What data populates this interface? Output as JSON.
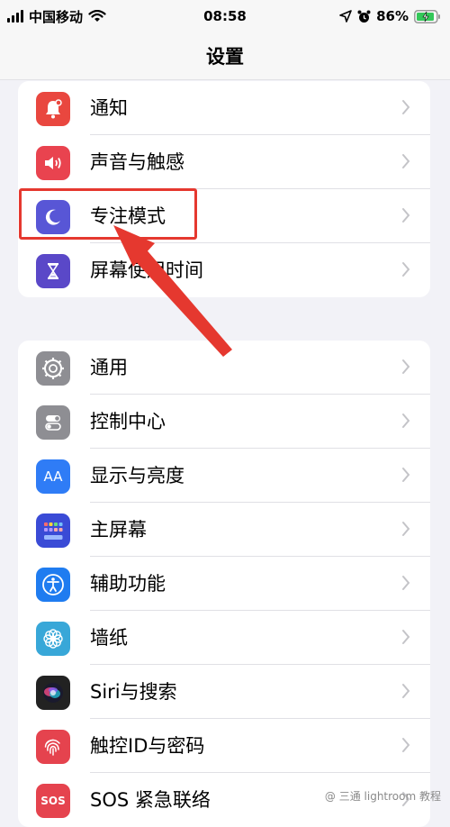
{
  "status_bar": {
    "carrier": "中国移动",
    "time": "08:58",
    "battery": "86%"
  },
  "nav": {
    "title": "设置"
  },
  "groups": [
    {
      "items": [
        {
          "label": "通知",
          "icon": "bell-icon",
          "color": "#e9473f"
        },
        {
          "label": "声音与触感",
          "icon": "speaker-icon",
          "color": "#e9434f"
        },
        {
          "label": "专注模式",
          "icon": "moon-icon",
          "color": "#5856d6"
        },
        {
          "label": "屏幕使用时间",
          "icon": "hourglass-icon",
          "color": "#5a48c8"
        }
      ]
    },
    {
      "items": [
        {
          "label": "通用",
          "icon": "gear-icon",
          "color": "#8e8e93"
        },
        {
          "label": "控制中心",
          "icon": "toggles-icon",
          "color": "#8e8e93"
        },
        {
          "label": "显示与亮度",
          "icon": "text-size-icon",
          "icon_text": "AA",
          "color": "#2f7cf6"
        },
        {
          "label": "主屏幕",
          "icon": "app-grid-icon",
          "color": "#3a4bd6"
        },
        {
          "label": "辅助功能",
          "icon": "accessibility-icon",
          "color": "#1f7cf0"
        },
        {
          "label": "墙纸",
          "icon": "flower-icon",
          "color": "#38a7d8"
        },
        {
          "label": "Siri与搜索",
          "icon": "siri-icon",
          "color": "#222222"
        },
        {
          "label": "触控ID与密码",
          "icon": "fingerprint-icon",
          "color": "#e5434e"
        },
        {
          "label": "SOS 紧急联络",
          "icon": "sos-icon",
          "icon_text": "SOS",
          "color": "#e5434e"
        }
      ]
    }
  ],
  "annotation": {
    "highlight_color": "#e5382f"
  },
  "watermark": "@ 三通 lightroom 教程"
}
